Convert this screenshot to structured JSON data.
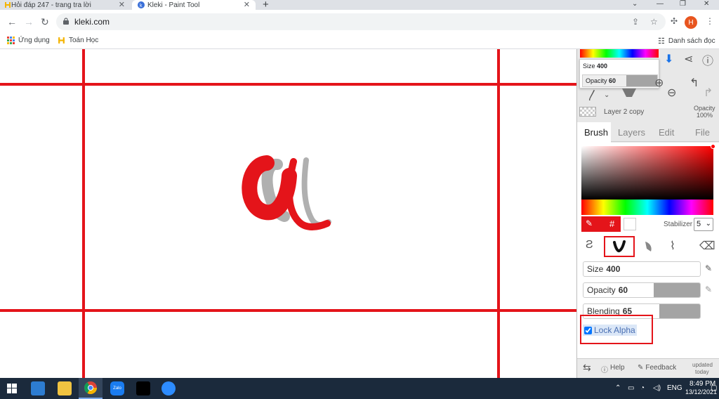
{
  "browser": {
    "tabs": [
      {
        "title": "Hỏi đáp 247 - trang tra lời",
        "active": false
      },
      {
        "title": "Kleki - Paint Tool",
        "active": true
      }
    ],
    "new_tab_icon": "+",
    "url": "kleki.com",
    "bookmarks": [
      "Ứng dụng",
      "Toán Học"
    ],
    "reading_list": "Danh sách đọc",
    "avatar_letter": "H"
  },
  "panel": {
    "popup": {
      "size_label": "Size",
      "size_value": "400",
      "opacity_label": "Opacity",
      "opacity_value": "60"
    },
    "layer_name": "Layer 2 copy",
    "layer_opacity_label": "Opacity",
    "layer_opacity_value": "100%",
    "tabs": [
      "Brush",
      "Layers",
      "Edit",
      "File"
    ],
    "active_tab": "Brush",
    "hash_symbol": "#",
    "stabilizer_label": "Stabilizer",
    "stabilizer_value": "5",
    "size_label": "Size",
    "size_value": "400",
    "size_fraction": 1.0,
    "opacity_label": "Opacity",
    "opacity_value": "60",
    "opacity_fraction": 0.6,
    "blending_label": "Blending",
    "blending_value": "65",
    "blending_fraction": 0.65,
    "lock_alpha_label": "Lock Alpha",
    "lock_alpha_checked": true,
    "help_label": "Help",
    "feedback_label": "Feedback",
    "updated_line1": "updated",
    "updated_line2": "today"
  },
  "taskbar": {
    "language": "ENG",
    "time": "8:49 PM",
    "date": "13/12/2021"
  },
  "colors": {
    "accent_red": "#e4141a",
    "brush_red": "#e4141a",
    "taskbar": "#1b2a3c"
  }
}
